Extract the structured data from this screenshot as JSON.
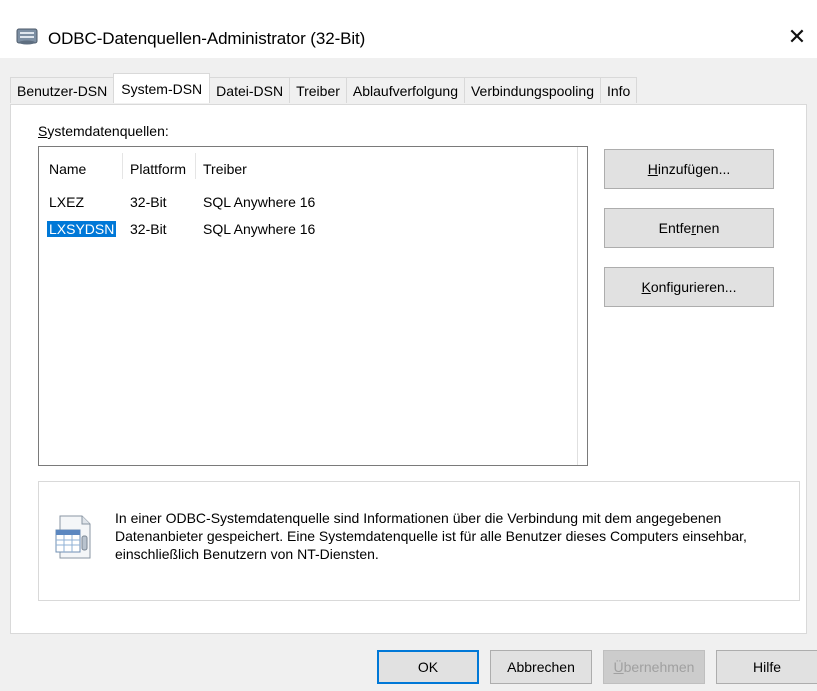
{
  "window": {
    "title": "ODBC-Datenquellen-Administrator (32-Bit)",
    "close_glyph": "✕"
  },
  "tabs": [
    {
      "label": "Benutzer-DSN",
      "active": false
    },
    {
      "label": "System-DSN",
      "active": true
    },
    {
      "label": "Datei-DSN",
      "active": false
    },
    {
      "label": "Treiber",
      "active": false
    },
    {
      "label": "Ablaufverfolgung",
      "active": false
    },
    {
      "label": "Verbindungspooling",
      "active": false
    },
    {
      "label": "Info",
      "active": false
    }
  ],
  "panel": {
    "group_label_first": "S",
    "group_label_rest": "ystemdatenquellen:",
    "columns": [
      "Name",
      "Plattform",
      "Treiber"
    ],
    "rows": [
      {
        "name": "LXEZ",
        "platform": "32-Bit",
        "driver": "SQL Anywhere 16",
        "selected": false
      },
      {
        "name": "LXSYDSN",
        "platform": "32-Bit",
        "driver": "SQL Anywhere 16",
        "selected": true
      }
    ],
    "buttons": {
      "add_pre": "",
      "add_u": "H",
      "add_post": "inzufügen...",
      "remove_pre": "Entfe",
      "remove_u": "r",
      "remove_post": "nen",
      "configure_pre": "",
      "configure_u": "K",
      "configure_post": "onfigurieren..."
    },
    "info_text": "In einer ODBC-Systemdatenquelle sind Informationen über die Verbindung mit dem angegebenen Datenanbieter gespeichert. Eine Systemdatenquelle ist für alle Benutzer dieses Computers einsehbar, einschließlich Benutzern von NT-Diensten."
  },
  "footer": {
    "ok": "OK",
    "cancel": "Abbrechen",
    "apply_u": "Ü",
    "apply_rest": "bernehmen",
    "help": "Hilfe"
  },
  "colors": {
    "selection": "#0078d7",
    "dialog_bg": "#f0f0f0"
  },
  "icons": {
    "title": "odbc-datasource-icon",
    "close": "close-icon",
    "info": "data-table-icon"
  }
}
